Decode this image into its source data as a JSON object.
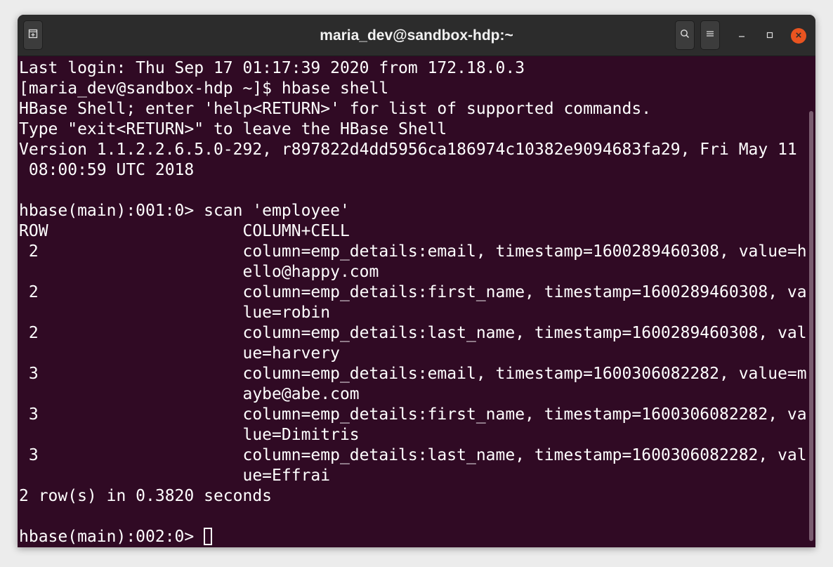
{
  "window": {
    "title": "maria_dev@sandbox-hdp:~"
  },
  "titlebar": {
    "icons": [
      "new-tab-icon",
      "search-icon",
      "hamburger-menu-icon",
      "minimize-icon",
      "maximize-icon",
      "close-icon"
    ]
  },
  "colors": {
    "terminal_bg": "#300a24",
    "text": "#ffffff",
    "titlebar_bg": "#2c2c2c",
    "close_accent": "#e95420"
  },
  "terminal": {
    "lines": [
      "Last login: Thu Sep 17 01:17:39 2020 from 172.18.0.3",
      "[maria_dev@sandbox-hdp ~]$ hbase shell",
      "HBase Shell; enter 'help<RETURN>' for list of supported commands.",
      "Type \"exit<RETURN>\" to leave the HBase Shell",
      "Version 1.1.2.2.6.5.0-292, r897822d4dd5956ca186974c10382e9094683fa29, Fri May 11",
      " 08:00:59 UTC 2018",
      "",
      "hbase(main):001:0> scan 'employee'",
      "ROW                    COLUMN+CELL",
      " 2                     column=emp_details:email, timestamp=1600289460308, value=h",
      "                       ello@happy.com",
      " 2                     column=emp_details:first_name, timestamp=1600289460308, va",
      "                       lue=robin",
      " 2                     column=emp_details:last_name, timestamp=1600289460308, val",
      "                       ue=harvery",
      " 3                     column=emp_details:email, timestamp=1600306082282, value=m",
      "                       aybe@abe.com",
      " 3                     column=emp_details:first_name, timestamp=1600306082282, va",
      "                       lue=Dimitris",
      " 3                     column=emp_details:last_name, timestamp=1600306082282, val",
      "                       ue=Effrai",
      "2 row(s) in 0.3820 seconds",
      ""
    ],
    "prompt": "hbase(main):002:0> "
  }
}
